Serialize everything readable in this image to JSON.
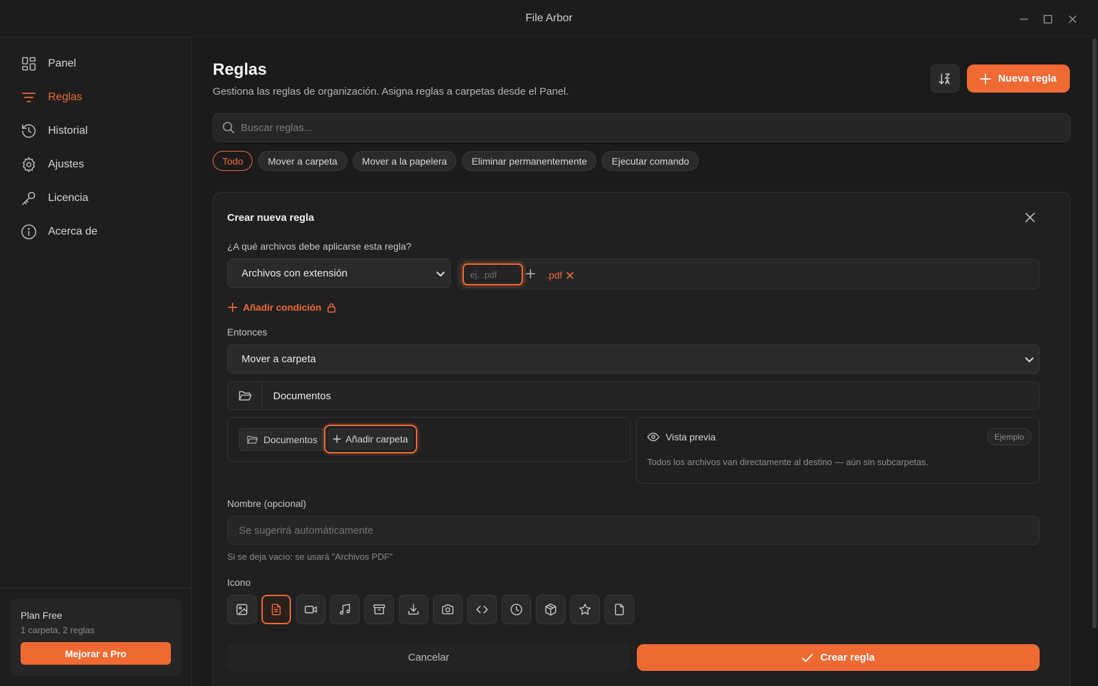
{
  "window": {
    "title": "File Arbor"
  },
  "sidebar": {
    "items": [
      {
        "label": "Panel",
        "icon": "dashboard-icon"
      },
      {
        "label": "Reglas",
        "icon": "filter-icon"
      },
      {
        "label": "Historial",
        "icon": "history-icon"
      },
      {
        "label": "Ajustes",
        "icon": "gear-icon"
      },
      {
        "label": "Licencia",
        "icon": "key-icon"
      },
      {
        "label": "Acerca de",
        "icon": "info-icon"
      }
    ],
    "active_item": "Reglas",
    "plan": {
      "name": "Plan Free",
      "usage": "1 carpeta, 2 reglas",
      "upgrade_label": "Mejorar a Pro"
    }
  },
  "header": {
    "title": "Reglas",
    "subtitle": "Gestiona las reglas de organización. Asigna reglas a carpetas desde el Panel.",
    "new_rule_label": "Nueva regla"
  },
  "search": {
    "placeholder": "Buscar reglas..."
  },
  "filters": {
    "chips": [
      "Todo",
      "Mover a carpeta",
      "Mover a la papelera",
      "Eliminar permanentemente",
      "Ejecutar comando"
    ],
    "active": "Todo"
  },
  "form": {
    "title": "Crear nueva regla",
    "condition_label": "¿A qué archivos debe aplicarse esta regla?",
    "condition_type": "Archivos con extensión",
    "extension_placeholder": "ej. .pdf",
    "extension_tags": [
      ".pdf"
    ],
    "add_condition_label": "Añadir condición",
    "then_label": "Entonces",
    "action": "Mover a carpeta",
    "destination": "Documentos",
    "folder_chips": [
      "Documentos"
    ],
    "add_folder_label": "Añadir carpeta",
    "preview": {
      "title": "Vista previa",
      "badge": "Ejemplo",
      "text": "Todos los archivos van directamente al destino — aún sin subcarpetas."
    },
    "name_label": "Nombre (opcional)",
    "name_placeholder": "Se sugerirá automáticamente",
    "name_hint": "Si se deja vacío: se usará \"Archivos PDF\"",
    "icon_label": "Icono",
    "icons": [
      "image-icon",
      "document-icon",
      "video-icon",
      "music-icon",
      "archive-icon",
      "download-icon",
      "camera-icon",
      "code-icon",
      "clock-icon",
      "package-icon",
      "star-icon",
      "file-icon"
    ],
    "selected_icon": "document-icon",
    "cancel_label": "Cancelar",
    "submit_label": "Crear regla"
  },
  "colors": {
    "accent": "#ef6a33",
    "background": "#1b1b1b",
    "sidebar": "#1e1e1e",
    "panel": "#202020"
  }
}
